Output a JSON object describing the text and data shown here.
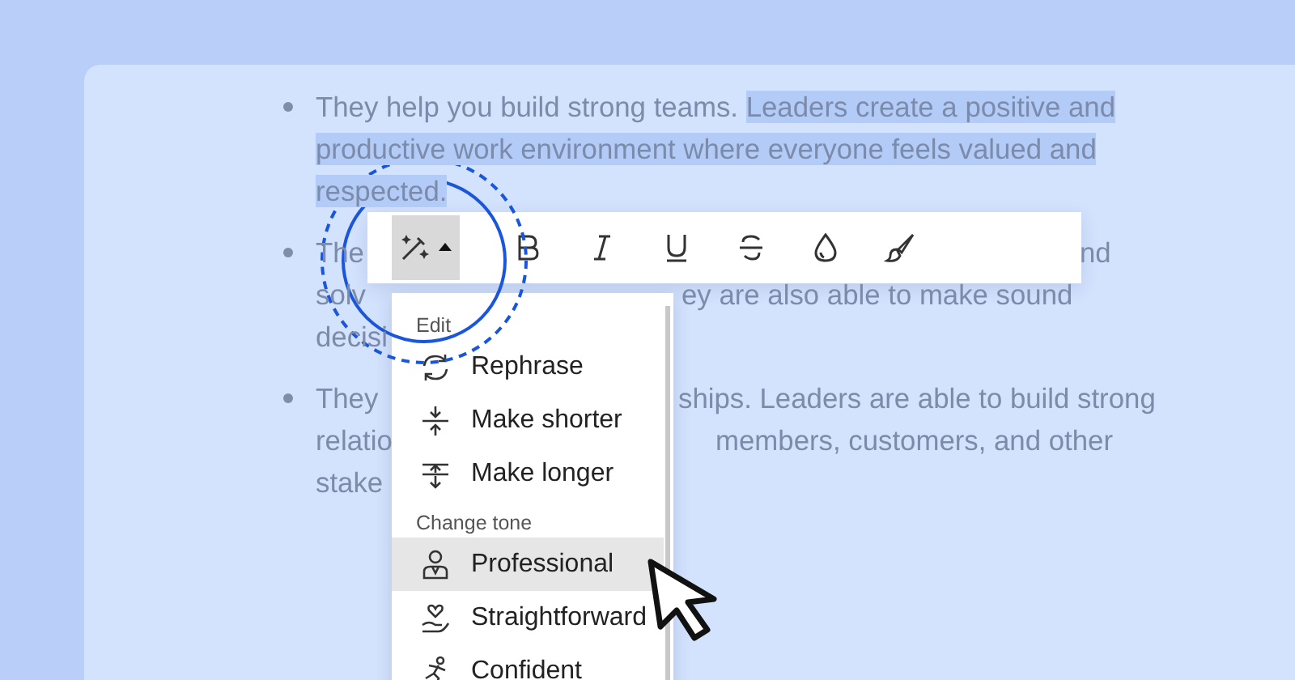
{
  "bullets": [
    {
      "kind": "full",
      "segments": [
        {
          "text": "They help you build strong teams. ",
          "selected": false
        },
        {
          "text": "Leaders create a positive and productive work environment where everyone feels valued and respected.",
          "selected": true
        }
      ]
    },
    {
      "kind": "covered",
      "lines": [
        {
          "left": "The",
          "right": "nd"
        },
        {
          "left": "solv",
          "right": "ey are also able to make sound"
        },
        {
          "left": "decisi"
        }
      ]
    },
    {
      "kind": "covered",
      "lines": [
        {
          "left": "They",
          "right": "ships. Leaders are able to build strong"
        },
        {
          "left": "relatio",
          "right": "members, customers, and other"
        },
        {
          "left": "stake"
        }
      ]
    }
  ],
  "toolbar": [
    {
      "kind": "magic",
      "selected": true
    },
    {
      "kind": "bold",
      "selected": false
    },
    {
      "kind": "italic",
      "selected": false
    },
    {
      "kind": "underline",
      "selected": false
    },
    {
      "kind": "strike",
      "selected": false
    },
    {
      "kind": "drop",
      "selected": false
    },
    {
      "kind": "brush",
      "selected": false
    }
  ],
  "menu": [
    {
      "kind": "header",
      "label": "Edit"
    },
    {
      "kind": "item",
      "label": "Rephrase",
      "selected": false
    },
    {
      "kind": "item",
      "label": "Make shorter",
      "selected": false
    },
    {
      "kind": "item",
      "label": "Make longer",
      "selected": false
    },
    {
      "kind": "header",
      "label": "Change tone"
    },
    {
      "kind": "item",
      "label": "Professional",
      "selected": true
    },
    {
      "kind": "item",
      "label": "Straightforward",
      "selected": false
    },
    {
      "kind": "item",
      "label": "Confident",
      "selected": false
    }
  ]
}
